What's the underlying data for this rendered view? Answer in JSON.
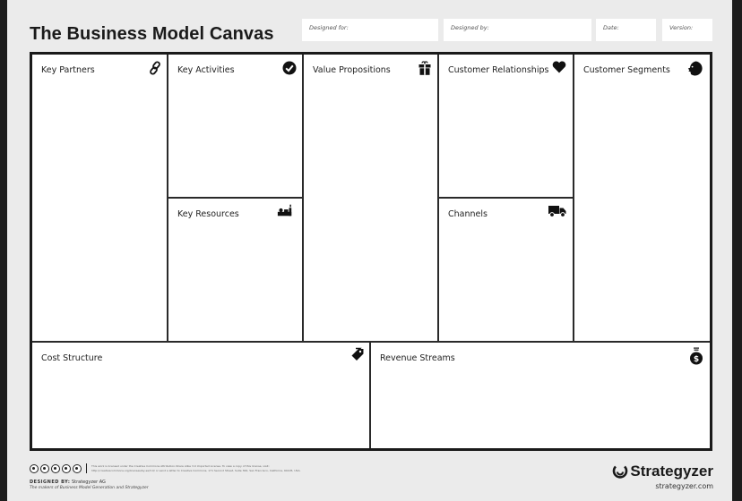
{
  "header": {
    "title": "The Business Model Canvas",
    "fields": [
      {
        "label": "Designed for:",
        "value": ""
      },
      {
        "label": "Designed by:",
        "value": ""
      },
      {
        "label": "Date:",
        "value": ""
      },
      {
        "label": "Version:",
        "value": ""
      }
    ]
  },
  "blocks": {
    "key_partners": {
      "label": "Key Partners",
      "icon": "link-icon"
    },
    "key_activities": {
      "label": "Key Activities",
      "icon": "checkmark-circle-icon"
    },
    "key_resources": {
      "label": "Key Resources",
      "icon": "factory-icon"
    },
    "value_propositions": {
      "label": "Value Propositions",
      "icon": "gift-icon"
    },
    "customer_relationships": {
      "label": "Customer Relationships",
      "icon": "heart-icon"
    },
    "channels": {
      "label": "Channels",
      "icon": "truck-icon"
    },
    "customer_segments": {
      "label": "Customer Segments",
      "icon": "head-icon"
    },
    "cost_structure": {
      "label": "Cost Structure",
      "icon": "price-tag-icon"
    },
    "revenue_streams": {
      "label": "Revenue Streams",
      "icon": "money-bag-icon"
    }
  },
  "footer": {
    "license_icons": [
      "cc-icon",
      "attribution-icon",
      "share-alike-icon",
      "noncommercial-icon",
      "info-icon"
    ],
    "license_text_line1": "This work is licensed under the Creative Commons Attribution-Share Alike 3.0 Unported License. To view a copy of this license, visit:",
    "license_text_line2": "http://creativecommons.org/licenses/by-sa/3.0/ or send a letter to Creative Commons, 171 Second Street, Suite 300, San Francisco, California, 94105, USA.",
    "designed_by_label": "DESIGNED BY:",
    "designed_by_value": "Strategyzer AG",
    "makers": "The makers of Business Model Generation and Strategyzer",
    "brand": "Strategyzer",
    "brand_url": "strategyzer.com"
  }
}
